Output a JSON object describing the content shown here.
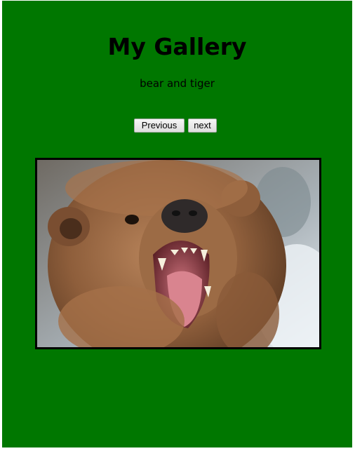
{
  "gallery": {
    "title": "My Gallery",
    "subtitle": "bear and tiger"
  },
  "controls": {
    "previous_label": "Previous",
    "next_label": "next"
  },
  "photo": {
    "subject": "roaring brown bear"
  },
  "colors": {
    "background": "#007700",
    "frame_border": "#000000",
    "title_text": "#000000"
  }
}
